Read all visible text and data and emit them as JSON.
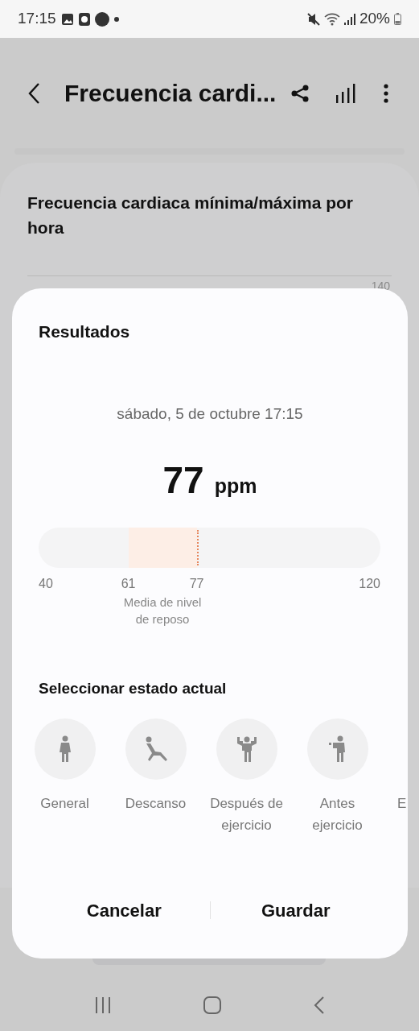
{
  "status_bar": {
    "time": "17:15",
    "battery": "20%"
  },
  "header": {
    "title": "Frecuencia cardi..."
  },
  "background_card": {
    "title": "Frecuencia cardiaca mínima/máxima por hora",
    "axis_label": "140"
  },
  "dialog": {
    "title": "Resultados",
    "date": "sábado, 5 de octubre 17:15",
    "value": "77",
    "unit": "ppm",
    "gauge": {
      "level": 0.4625,
      "ticks": [
        "40",
        "61",
        "77",
        "120"
      ],
      "band_caption": "Media de nivel de reposo"
    },
    "states_title": "Seleccionar estado actual",
    "states": [
      {
        "kind": "standing",
        "label": "General",
        "selected": false
      },
      {
        "kind": "resting",
        "label": "Descanso",
        "selected": false
      },
      {
        "kind": "flexing",
        "label": "Después de ejercicio",
        "selected": false
      },
      {
        "kind": "warmup",
        "label": "Antes ejercicio",
        "selected": false
      },
      {
        "kind": "cut",
        "label": "E",
        "selected": false
      }
    ],
    "buttons": [
      "Cancelar",
      "Guardar"
    ]
  }
}
